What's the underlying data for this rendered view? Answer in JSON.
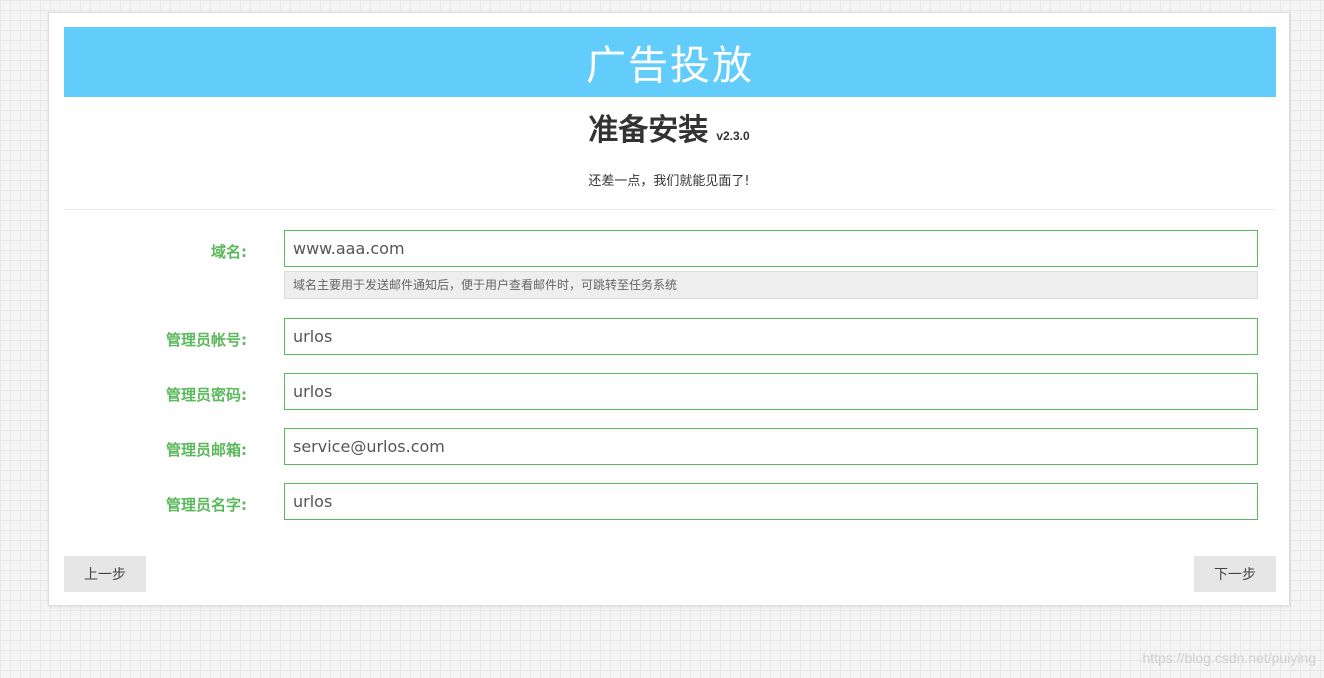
{
  "banner": {
    "title": "广告投放"
  },
  "heading": {
    "title": "准备安装",
    "version": "v2.3.0"
  },
  "subtitle": "还差一点，我们就能见面了!",
  "form": {
    "domain": {
      "label": "域名:",
      "value": "www.aaa.com",
      "help": "域名主要用于发送邮件通知后，便于用户查看邮件时，可跳转至任务系统"
    },
    "admin_account": {
      "label": "管理员帐号:",
      "value": "urlos"
    },
    "admin_password": {
      "label": "管理员密码:",
      "value": "urlos"
    },
    "admin_email": {
      "label": "管理员邮箱:",
      "value": "service@urlos.com"
    },
    "admin_name": {
      "label": "管理员名字:",
      "value": "urlos"
    }
  },
  "buttons": {
    "prev": "上一步",
    "next": "下一步"
  },
  "watermark": "https://blog.csdn.net/puiying",
  "colors": {
    "banner": "#62cdfa",
    "label": "#5cb85c",
    "input_border": "#5cb85c"
  }
}
